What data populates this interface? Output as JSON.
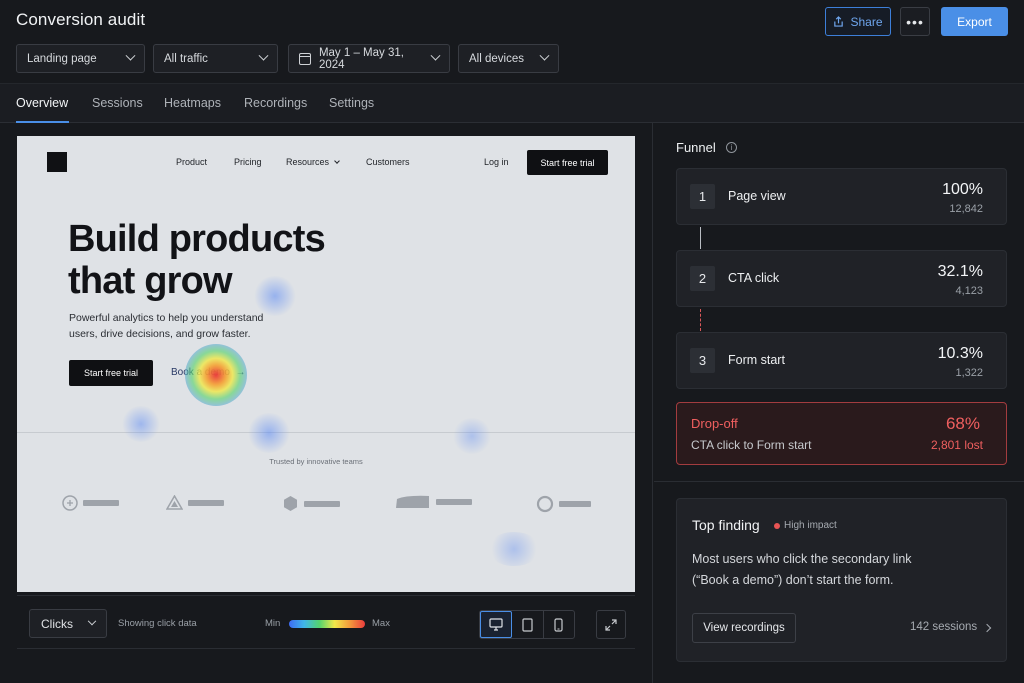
{
  "header": {
    "title": "Conversion audit",
    "share_label": "Share",
    "more_label": "•••",
    "export_label": "Export"
  },
  "filters": {
    "page": "Landing page",
    "traffic": "All traffic",
    "date_range": "May 1 – May 31, 2024",
    "devices": "All devices"
  },
  "tabs": [
    {
      "label": "Overview"
    },
    {
      "label": "Sessions"
    },
    {
      "label": "Heatmaps"
    },
    {
      "label": "Recordings"
    },
    {
      "label": "Settings"
    }
  ],
  "preview": {
    "nav": [
      "Product",
      "Pricing",
      "Resources",
      "Customers"
    ],
    "login": "Log in",
    "nav_cta": "Start free trial",
    "hero_line1": "Build products",
    "hero_line2": "that grow",
    "subtext_line1": "Powerful analytics to help you understand",
    "subtext_line2": "users, drive decisions, and grow faster.",
    "cta": "Start free trial",
    "demo_link": "Book a demo",
    "trusted": "Trusted by innovative teams"
  },
  "toolbar": {
    "mode": "Clicks",
    "showing": "Showing click data",
    "min_label": "Min",
    "max_label": "Max",
    "active_device": "desktop"
  },
  "funnel": {
    "title": "Funnel",
    "steps": [
      {
        "num": "1",
        "label": "Page view",
        "pct": "100%",
        "count": "12,842"
      },
      {
        "num": "2",
        "label": "CTA click",
        "pct": "32.1%",
        "count": "4,123"
      },
      {
        "num": "3",
        "label": "Form start",
        "pct": "10.3%",
        "count": "1,322"
      }
    ],
    "dropoff": {
      "title": "Drop-off",
      "desc": "CTA click to Form start",
      "pct": "68%",
      "lost": "2,801 lost"
    }
  },
  "finding": {
    "title": "Top finding",
    "impact": "High impact",
    "body_line1": "Most users who click the secondary link",
    "body_line2": "(“Book a demo”) don’t start the form.",
    "button": "View recordings",
    "sessions": "142 sessions"
  },
  "colors": {
    "accent": "#4a8fe7",
    "danger": "#ef5f5f",
    "background": "#17191d"
  }
}
